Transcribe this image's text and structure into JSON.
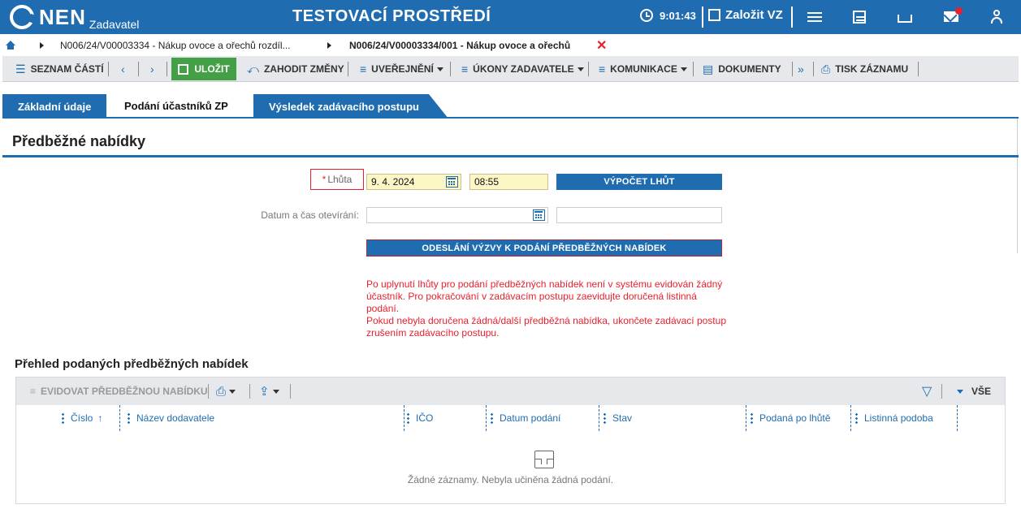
{
  "topbar": {
    "logo_text": "NEN",
    "logo_sub": "Zadavatel",
    "env_title": "TESTOVACÍ PROSTŘEDÍ",
    "clock": "9:01:43",
    "create_label": "Založit VZ"
  },
  "breadcrumb": {
    "item1": "N006/24/V00003334 - Nákup ovoce a ořechů rozdíl...",
    "item2": "N006/24/V00003334/001 - Nákup ovoce a ořechů",
    "close": "✕"
  },
  "toolbar": {
    "parts_list": "SEZNAM ČÁSTÍ",
    "save": "ULOŽIT",
    "discard": "ZAHODIT ZMĚNY",
    "publications": "UVEŘEJNĚNÍ",
    "actions": "ÚKONY ZADAVATELE",
    "communication": "KOMUNIKACE",
    "documents": "DOKUMENTY",
    "print": "TISK ZÁZNAMU"
  },
  "tabs": [
    {
      "label": "Základní údaje"
    },
    {
      "label": "Podání účastníků ZP"
    },
    {
      "label": "Výsledek zadávacího postupu"
    }
  ],
  "section_title": "Předběžné nabídky",
  "form": {
    "deadline_required": "*",
    "deadline_label": "Lhůta",
    "deadline_date": "9. 4. 2024",
    "deadline_time": "08:55",
    "calc_button": "VÝPOČET LHŮT",
    "opening_label": "Datum a čas otevírání:",
    "opening_date": "",
    "opening_time": "",
    "send_button": "ODESLÁNÍ VÝZVY K PODÁNÍ PŘEDBĚŽNÝCH NABÍDEK",
    "warning_1": "Po uplynutí lhůty pro podání předběžných nabídek není v systému evidován žádný účastník. Pro pokračování v zadávacím postupu zaevidujte doručená listinná podání.",
    "warning_2": "Pokud nebyla doručena žádná/další předběžná nabídka, ukončete zadávací postup zrušením zadávacího postupu."
  },
  "grid": {
    "title": "Přehled podaných předběžných nabídek",
    "add_button": "EVIDOVAT PŘEDBĚŽNOU NABÍDKU",
    "all_label": "VŠE",
    "columns": [
      "Číslo",
      "Název dodavatele",
      "IČO",
      "Datum podání",
      "Stav",
      "Podaná po lhůtě",
      "Listinná podoba"
    ],
    "sort_indicator": "↑",
    "empty_text": "Žádné záznamy. Nebyla učiněna žádná podání."
  },
  "colors": {
    "brand_blue": "#1f6db0",
    "save_green": "#43a047",
    "warning_red": "#e8202e",
    "required_field": "#fdf6c6"
  }
}
